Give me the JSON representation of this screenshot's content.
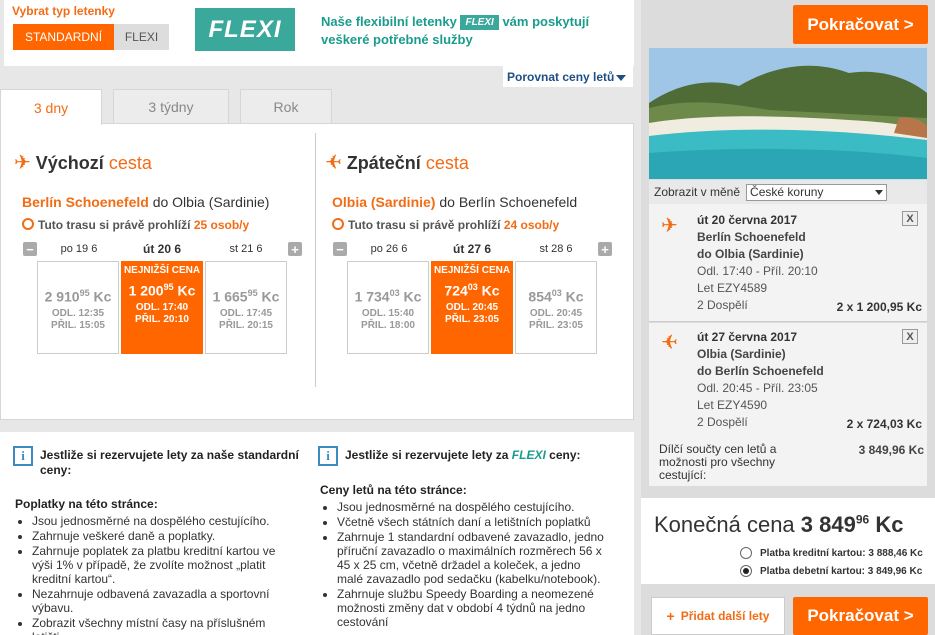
{
  "fare_type": {
    "title": "Vybrat typ letenky",
    "standard_label": "STANDARDNÍ",
    "flexi_label": "FLEXI",
    "logo_text": "FLEXI",
    "desc_before": "Naše flexibilní letenky",
    "desc_pill": "FLEXI",
    "desc_after": "vám poskytují veškeré potřebné služby",
    "compare_link": "Porovnat ceny letů"
  },
  "tabs": [
    {
      "label": "3 dny"
    },
    {
      "label": "3 týdny"
    },
    {
      "label": "Rok"
    }
  ],
  "outbound": {
    "title_bold": "Výchozí",
    "title_light": "cesta",
    "from": "Berlín Schoenefeld",
    "to": "do Olbia (Sardinie)",
    "viewers_text": "Tuto trasu si právě prohlíží",
    "viewers_count": "25 osob/y",
    "dates": [
      "po 19 6",
      "út 20 6",
      "st 21 6"
    ],
    "cards": [
      {
        "price_main": "2 910",
        "price_dec": "95",
        "currency": "Kc",
        "dep": "ODL. 12:35",
        "arr": "PŘIL. 15:05"
      },
      {
        "label": "NEJNIŽŠÍ CENA",
        "price_main": "1 200",
        "price_dec": "95",
        "currency": "Kc",
        "dep": "ODL. 17:40",
        "arr": "PŘIL. 20:10"
      },
      {
        "price_main": "1 665",
        "price_dec": "95",
        "currency": "Kc",
        "dep": "ODL. 17:45",
        "arr": "PŘIL. 20:15"
      }
    ]
  },
  "inbound": {
    "title_bold": "Zpáteční",
    "title_light": "cesta",
    "from": "Olbia (Sardinie)",
    "to": "do Berlín Schoenefeld",
    "viewers_text": "Tuto trasu si právě prohlíží",
    "viewers_count": "24 osob/y",
    "dates": [
      "po 26 6",
      "út 27 6",
      "st 28 6"
    ],
    "cards": [
      {
        "price_main": "1 734",
        "price_dec": "03",
        "currency": "Kc",
        "dep": "ODL. 15:40",
        "arr": "PŘIL. 18:00"
      },
      {
        "label": "NEJNIŽŠÍ CENA",
        "price_main": "724",
        "price_dec": "03",
        "currency": "Kc",
        "dep": "ODL. 20:45",
        "arr": "PŘIL. 23:05"
      },
      {
        "price_main": "854",
        "price_dec": "03",
        "currency": "Kc",
        "dep": "ODL. 20:45",
        "arr": "PŘIL. 23:05"
      }
    ]
  },
  "info_standard": {
    "head": "Jestliže si rezervujete lety za naše standardní ceny:",
    "sub": "Poplatky na této stránce:",
    "items": [
      "Jsou jednosměrné na dospělého cestujícího.",
      "Zahrnuje veškeré daně a poplatky.",
      "Zahrnuje poplatek za platbu kreditní kartou ve výši 1% v případě, že zvolíte možnost „platit kreditní kartou“.",
      "Nezahrnuje odbavená zavazadla a sportovní výbavu.",
      "Zobrazit všechny místní časy na příslušném letišti"
    ]
  },
  "info_flexi": {
    "head_before": "Jestliže si rezervujete lety za",
    "head_flexi": "FLEXI",
    "head_after": "ceny:",
    "sub": "Ceny letů na této stránce:",
    "items": [
      "Jsou jednosměrné na dospělého cestujícího.",
      "Včetně všech státních daní a letištních poplatků",
      "Zahrnuje 1 standardní odbavené zavazadlo, jedno příruční zavazadlo o maximálních rozměrech 56 x 45 x 25 cm, včetně držadel a koleček, a jedno malé zavazadlo pod sedačku (kabelku/notebook).",
      "Zahrnuje službu Speedy Boarding a neomezené možnosti změny dat v období 4 týdnů na jedno cestování"
    ]
  },
  "sidebar": {
    "continue_label": "Pokračovat",
    "continue_arrow": ">",
    "currency_label": "Zobrazit v měně",
    "currency_value": "České koruny",
    "legs": [
      {
        "date": "út 20 června 2017",
        "from": "Berlín Schoenefeld",
        "to": "do Olbia (Sardinie)",
        "times": "Odl. 17:40 - Příl. 20:10",
        "flight": "Let EZY4589",
        "pax": "2 Dospělí",
        "price": "2 x 1 200,95 Kc",
        "close": "X"
      },
      {
        "date": "út 27 června 2017",
        "from": "Olbia (Sardinie)",
        "to": "do Berlín Schoenefeld",
        "times": "Odl. 20:45 - Příl. 23:05",
        "flight": "Let EZY4590",
        "pax": "2 Dospělí",
        "price": "2 x 724,03 Kc",
        "close": "X"
      }
    ],
    "subtotal_label": "Dílčí součty cen letů a možnosti pro všechny cestující:",
    "subtotal_value": "3 849,96 Kc",
    "final_label": "Konečná cena",
    "final_main": "3 849",
    "final_dec": "96",
    "final_currency": "Kc",
    "pay_credit": "Platba kreditní kartou: 3 888,46 Kc",
    "pay_debit": "Platba debetní kartou: 3 849,96 Kc",
    "pay_selected": "debit",
    "add_flights": "Přidat další lety",
    "add_plus": "+"
  },
  "colors": {
    "accent": "#ff6600",
    "teal": "#3aa89a",
    "link": "#1f4f86"
  }
}
